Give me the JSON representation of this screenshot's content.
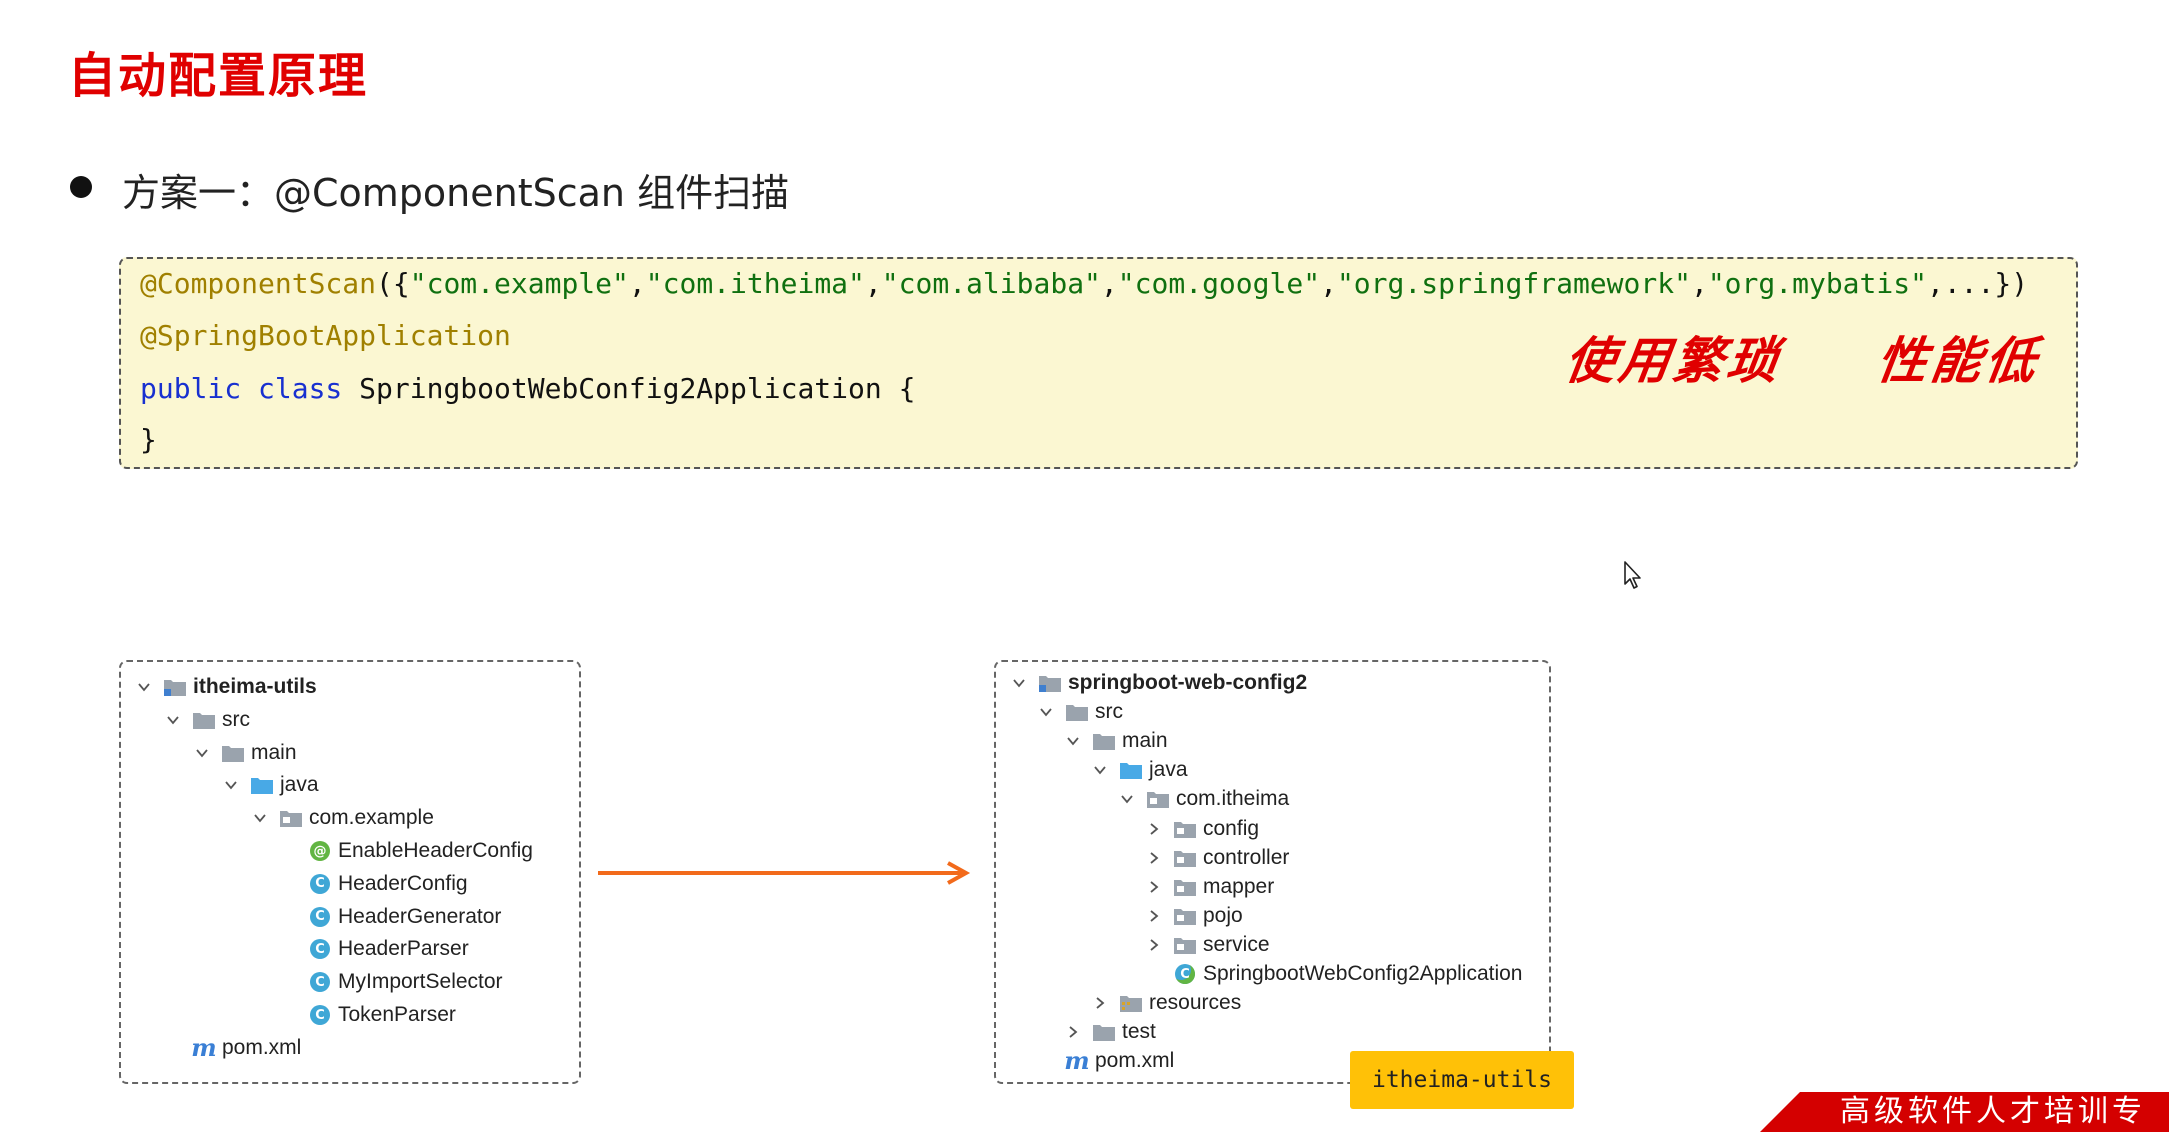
{
  "title": "自动配置原理",
  "subtitle": "方案一：@ComponentScan 组件扫描",
  "code": {
    "line1": [
      {
        "t": "@ComponentScan",
        "c": "ann"
      },
      {
        "t": "({",
        "c": "pl"
      },
      {
        "t": "\"com.example\"",
        "c": "str"
      },
      {
        "t": ",",
        "c": "pl"
      },
      {
        "t": "\"com.itheima\"",
        "c": "str"
      },
      {
        "t": ",",
        "c": "pl"
      },
      {
        "t": "\"com.alibaba\"",
        "c": "str"
      },
      {
        "t": ",",
        "c": "pl"
      },
      {
        "t": "\"com.google\"",
        "c": "str"
      },
      {
        "t": ",",
        "c": "pl"
      },
      {
        "t": "\"org.springframework\"",
        "c": "str"
      },
      {
        "t": ",",
        "c": "pl"
      },
      {
        "t": "\"org.mybatis\"",
        "c": "str"
      },
      {
        "t": ",...})",
        "c": "pl"
      }
    ],
    "line2": [
      {
        "t": "@SpringBootApplication",
        "c": "ann"
      }
    ],
    "line3": [
      {
        "t": "public class",
        "c": "kw"
      },
      {
        "t": " SpringbootWebConfig2Application {",
        "c": "pl"
      }
    ],
    "line4": [
      {
        "t": "}",
        "c": "pl"
      }
    ]
  },
  "handwritten": {
    "note1": "使用繁琐",
    "note2": "性能低"
  },
  "left_tree": [
    {
      "label": "itheima-utils",
      "icon": "module-folder-icon",
      "chevron": "down",
      "level": 0,
      "bold": true
    },
    {
      "label": "src",
      "icon": "folder-icon",
      "chevron": "down",
      "level": 1
    },
    {
      "label": "main",
      "icon": "folder-icon",
      "chevron": "down",
      "level": 2
    },
    {
      "label": "java",
      "icon": "source-folder-icon",
      "chevron": "down",
      "level": 3
    },
    {
      "label": "com.example",
      "icon": "package-icon",
      "chevron": "down",
      "level": 4
    },
    {
      "label": "EnableHeaderConfig",
      "icon": "annotation-icon",
      "chevron": "none",
      "level": 5
    },
    {
      "label": "HeaderConfig",
      "icon": "class-icon",
      "chevron": "none",
      "level": 5
    },
    {
      "label": "HeaderGenerator",
      "icon": "class-icon",
      "chevron": "none",
      "level": 5
    },
    {
      "label": "HeaderParser",
      "icon": "class-icon",
      "chevron": "none",
      "level": 5
    },
    {
      "label": "MyImportSelector",
      "icon": "class-icon",
      "chevron": "none",
      "level": 5
    },
    {
      "label": "TokenParser",
      "icon": "class-icon",
      "chevron": "none",
      "level": 5
    },
    {
      "label": "pom.xml",
      "icon": "maven-icon",
      "chevron": "none",
      "level": 1
    }
  ],
  "right_tree": [
    {
      "label": "springboot-web-config2",
      "icon": "module-folder-icon",
      "chevron": "down",
      "level": 0,
      "bold": true
    },
    {
      "label": "src",
      "icon": "folder-icon",
      "chevron": "down",
      "level": 1
    },
    {
      "label": "main",
      "icon": "folder-icon",
      "chevron": "down",
      "level": 2
    },
    {
      "label": "java",
      "icon": "source-folder-icon",
      "chevron": "down",
      "level": 3
    },
    {
      "label": "com.itheima",
      "icon": "package-icon",
      "chevron": "down",
      "level": 4
    },
    {
      "label": "config",
      "icon": "package-icon",
      "chevron": "right",
      "level": 5
    },
    {
      "label": "controller",
      "icon": "package-icon",
      "chevron": "right",
      "level": 5
    },
    {
      "label": "mapper",
      "icon": "package-icon",
      "chevron": "right",
      "level": 5
    },
    {
      "label": "pojo",
      "icon": "package-icon",
      "chevron": "right",
      "level": 5
    },
    {
      "label": "service",
      "icon": "package-icon",
      "chevron": "right",
      "level": 5
    },
    {
      "label": "SpringbootWebConfig2Application",
      "icon": "spring-class-icon",
      "chevron": "none",
      "level": 5
    },
    {
      "label": "resources",
      "icon": "resources-folder-icon",
      "chevron": "right",
      "level": 3
    },
    {
      "label": "test",
      "icon": "folder-icon",
      "chevron": "right",
      "level": 2
    },
    {
      "label": "pom.xml",
      "icon": "maven-icon",
      "chevron": "none",
      "level": 1
    }
  ],
  "jar_label": "itheima-utils",
  "banner_text": "高级软件人才培训专",
  "colors": {
    "title": "#e00000",
    "code_bg": "#fbf7d2",
    "annotation": "#a08000",
    "string": "#107010",
    "keyword": "#1830d0",
    "arrow": "#f26a1b",
    "jar_label_bg": "#ffc107",
    "banner": "#d40000"
  }
}
